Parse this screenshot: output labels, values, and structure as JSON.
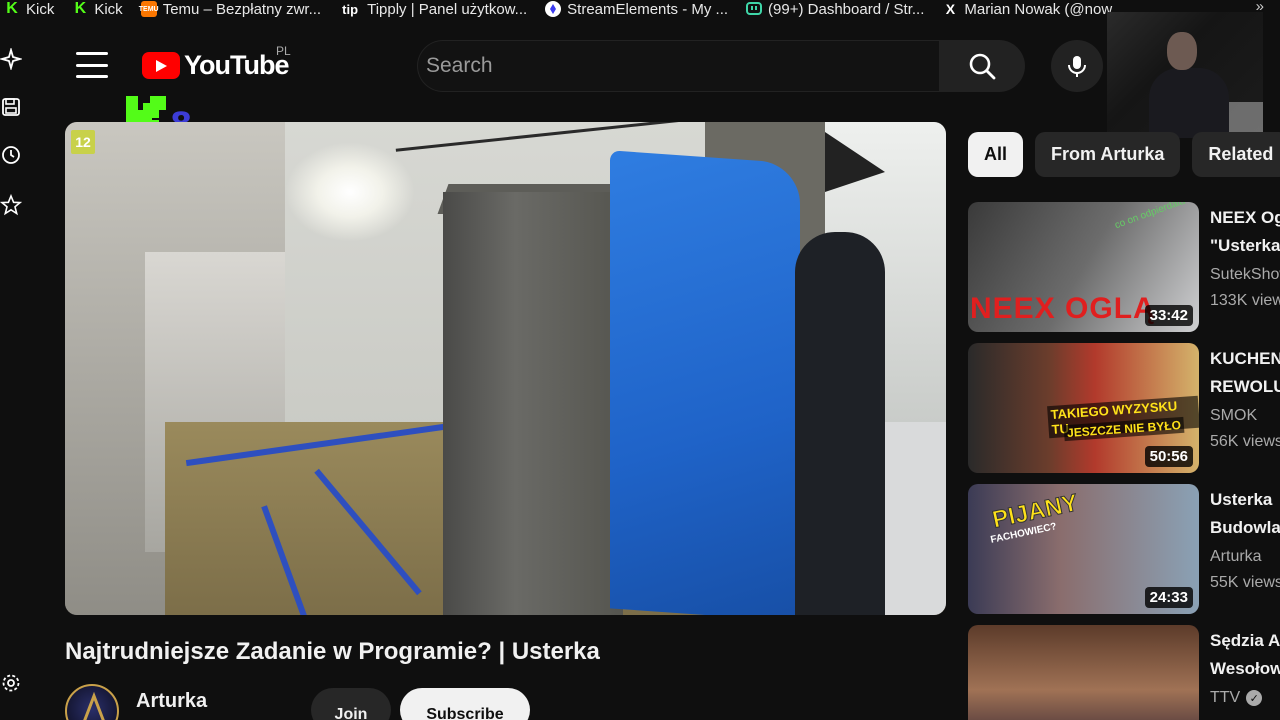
{
  "bookmarks": [
    {
      "label": "Kick",
      "icon": "kick-icon"
    },
    {
      "label": "Kick",
      "icon": "kick-icon"
    },
    {
      "label": "Temu – Bezpłatny zwr...",
      "icon": "temu-icon",
      "badge": "TEMU"
    },
    {
      "label": "Tipply | Panel użytkow...",
      "icon": "tipply-icon",
      "badge": "tip"
    },
    {
      "label": "StreamElements - My ...",
      "icon": "streamelements-icon"
    },
    {
      "label": "(99+) Dashboard / Str...",
      "icon": "twitch-icon"
    },
    {
      "label": "Marian Nowak (@now",
      "icon": "x-icon",
      "badge": "X"
    }
  ],
  "header": {
    "logo_text": "YouTube",
    "region": "PL",
    "search_placeholder": "Search"
  },
  "kick_overlay": {
    "count": "8"
  },
  "video": {
    "age_rating": "12",
    "title": "Najtrudniejsze Zadanie w Programie? | Usterka",
    "channel": "Arturka",
    "join_label": "Join",
    "subscribe_label": "Subscribe"
  },
  "chips": [
    {
      "label": "All",
      "active": true
    },
    {
      "label": "From Arturka",
      "active": false
    },
    {
      "label": "Related",
      "active": false
    }
  ],
  "recommendations": [
    {
      "title1": "NEEX Og",
      "title2": "\"Usterka",
      "channel": "SutekShow",
      "views": "133K views",
      "duration": "33:42",
      "thumb_text": "NEEX OGLĄ",
      "thumb_stamp": "co on odpierdala"
    },
    {
      "title1": "KUCHEN",
      "title2": "REWOLU",
      "channel": "SMOK",
      "views": "56K views",
      "duration": "50:56",
      "thumb_text": "TAKIEGO WYZYSKU TU",
      "thumb_text2": "JESZCZE NIE BYŁO"
    },
    {
      "title1": "Usterka",
      "title2": "Budowla",
      "channel": "Arturka",
      "views": "55K views",
      "duration": "24:33",
      "thumb_text": "PIJANY",
      "thumb_text2": "FACHOWIEC?"
    },
    {
      "title1": "Sędzia A",
      "title2": "Wesołow",
      "channel": "TTV",
      "views": "",
      "duration": "",
      "verified": true
    }
  ],
  "colors": {
    "background": "#0f0f0f",
    "brand_red": "#ff0000",
    "kick_green": "#53fc18",
    "text_primary": "#f1f1f1",
    "text_secondary": "#aaaaaa"
  }
}
